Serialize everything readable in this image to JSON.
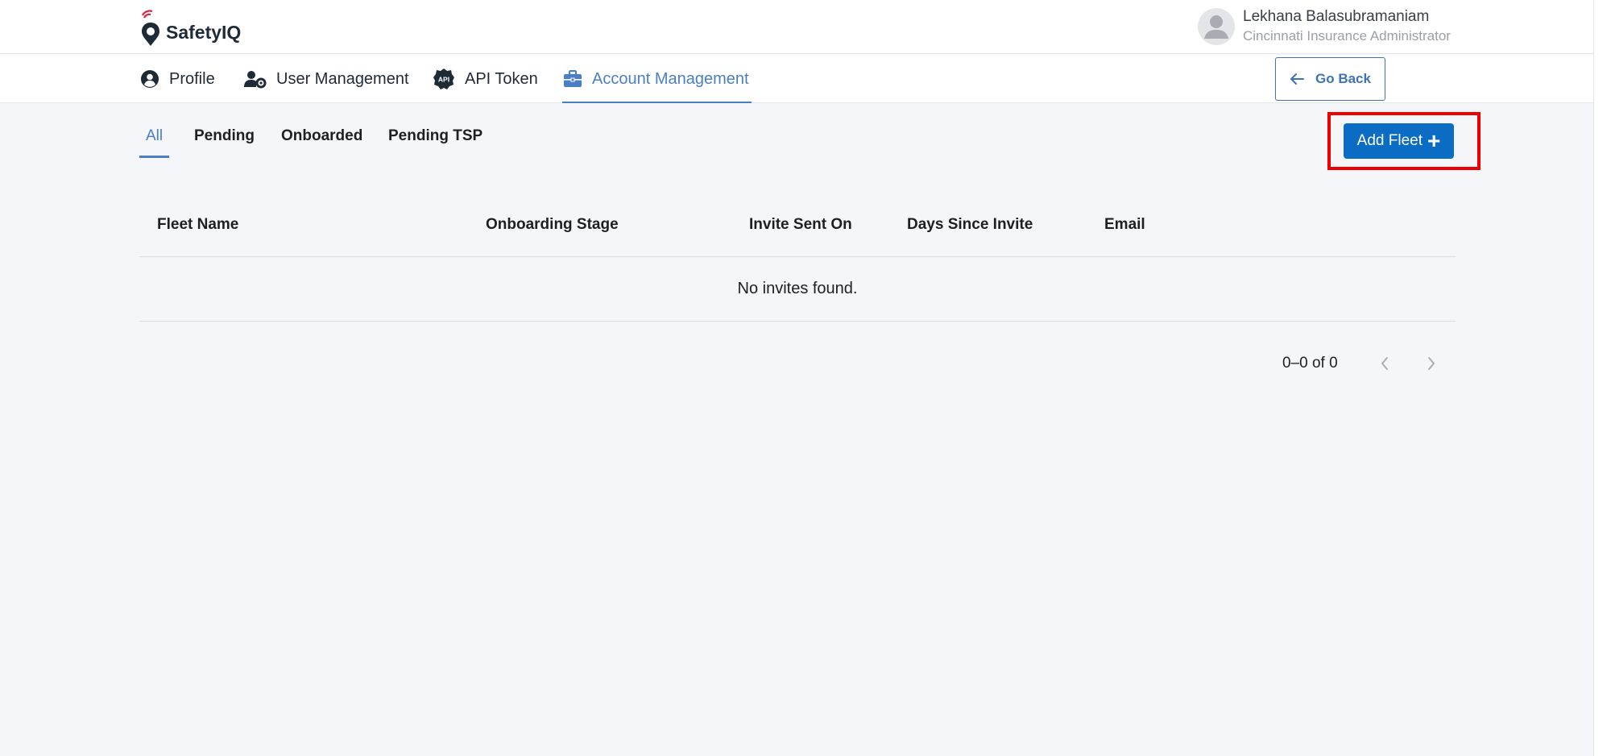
{
  "brand": {
    "name": "SafetyIQ"
  },
  "user": {
    "name": "Lekhana Balasubramaniam",
    "role": "Cincinnati Insurance Administrator"
  },
  "nav": {
    "items": [
      {
        "label": "Profile",
        "icon": "user-circle-icon"
      },
      {
        "label": "User Management",
        "icon": "user-gear-icon"
      },
      {
        "label": "API Token",
        "icon": "api-gear-icon"
      },
      {
        "label": "Account Management",
        "icon": "briefcase-icon",
        "active": true
      }
    ],
    "go_back_label": "Go Back"
  },
  "subtabs": [
    {
      "label": "All",
      "active": true
    },
    {
      "label": "Pending"
    },
    {
      "label": "Onboarded"
    },
    {
      "label": "Pending TSP"
    }
  ],
  "actions": {
    "add_fleet_label": "Add Fleet",
    "add_fleet_icon": "+"
  },
  "table": {
    "columns": [
      "Fleet Name",
      "Onboarding Stage",
      "Invite Sent On",
      "Days Since Invite",
      "Email"
    ],
    "empty_message": "No invites found."
  },
  "pagination": {
    "range": "0–0 of 0"
  },
  "colors": {
    "accent": "#4b7fc4",
    "primary_button": "#0a6cc2",
    "highlight": "#ee0000",
    "logo_signal": "#e0203a"
  }
}
